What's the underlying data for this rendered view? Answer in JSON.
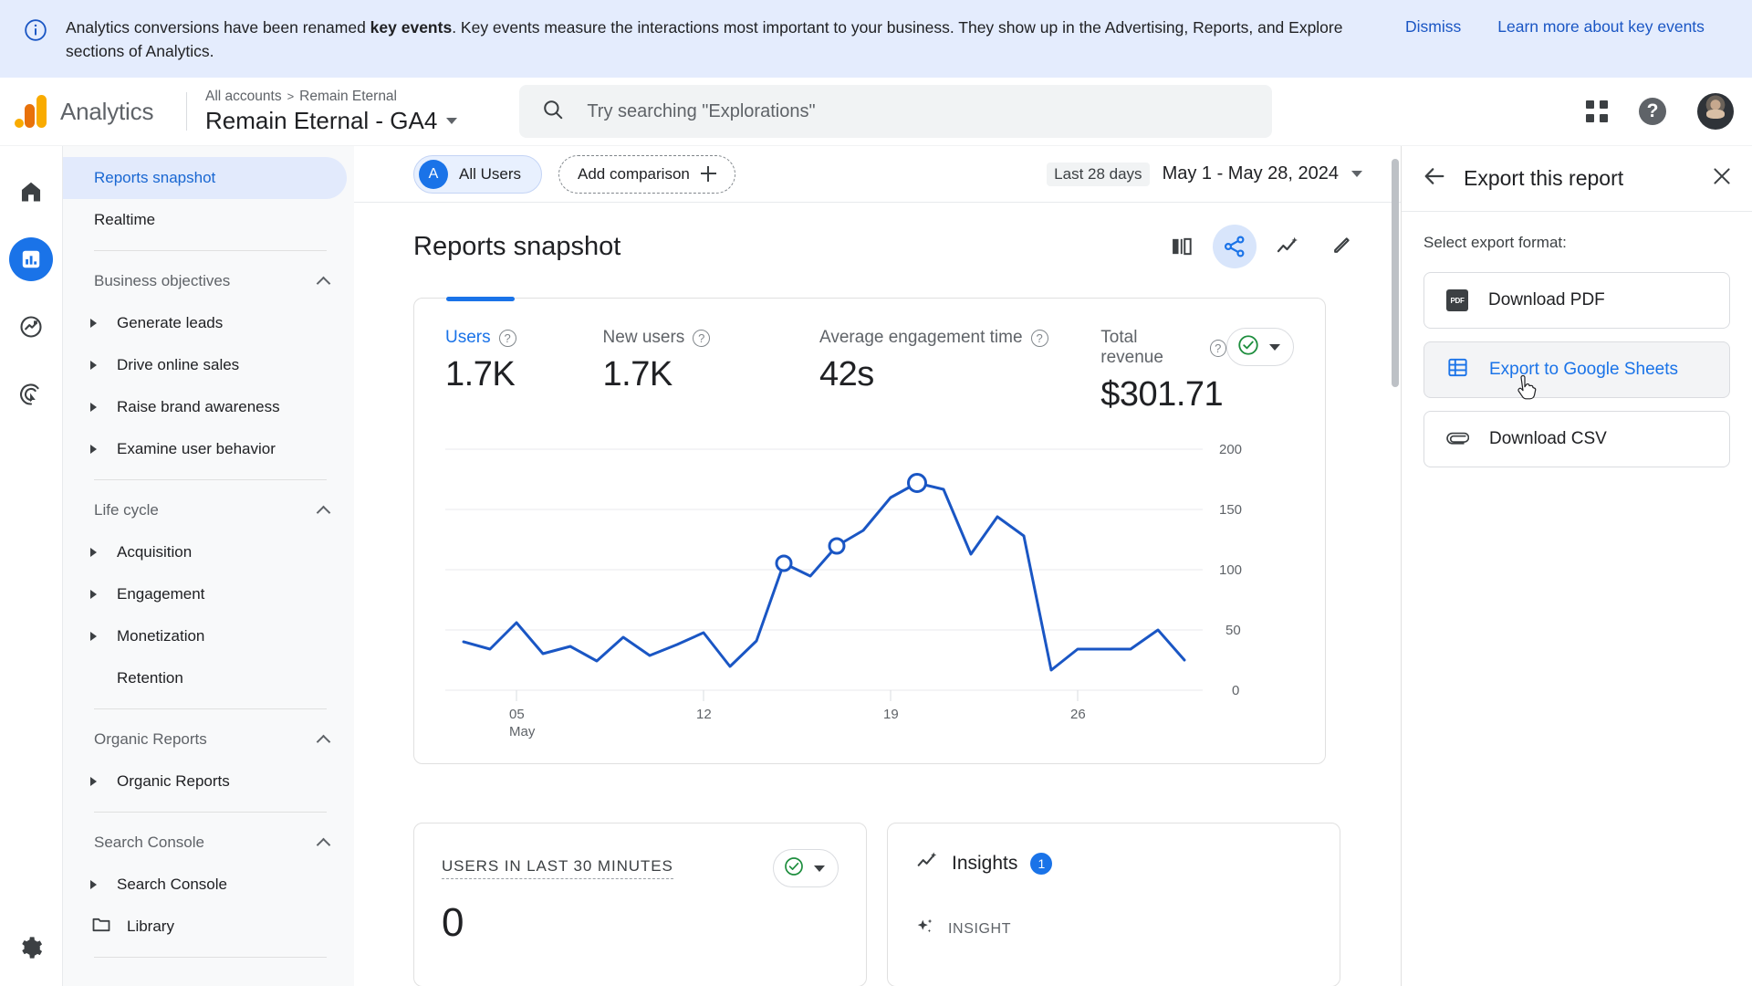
{
  "banner": {
    "icon": "info-icon",
    "text_before": "Analytics conversions have been renamed ",
    "text_bold": "key events",
    "text_after": ". Key events measure the interactions most important to your business. They show up in the Advertising, Reports, and Explore sections of Analytics.",
    "dismiss_label": "Dismiss",
    "learn_more_label": "Learn more about key events"
  },
  "header": {
    "product_name": "Analytics",
    "breadcrumb_root": "All accounts",
    "breadcrumb_separator": ">",
    "breadcrumb_account": "Remain Eternal",
    "property_name": "Remain Eternal - GA4",
    "search_placeholder": "Try searching \"Explorations\"",
    "search_value": "",
    "help_glyph": "?"
  },
  "rail": {
    "items": [
      {
        "name": "home-icon",
        "active": false
      },
      {
        "name": "reports-icon",
        "active": true
      },
      {
        "name": "explore-icon",
        "active": false
      },
      {
        "name": "advertising-icon",
        "active": false
      }
    ],
    "settings_icon": "gear-icon"
  },
  "sidebar": {
    "top_items": [
      {
        "label": "Reports snapshot",
        "selected": true
      },
      {
        "label": "Realtime",
        "selected": false
      }
    ],
    "sections": [
      {
        "title": "Business objectives",
        "collapsed": false,
        "items": [
          {
            "label": "Generate leads",
            "expandable": true
          },
          {
            "label": "Drive online sales",
            "expandable": true
          },
          {
            "label": "Raise brand awareness",
            "expandable": true
          },
          {
            "label": "Examine user behavior",
            "expandable": true
          }
        ]
      },
      {
        "title": "Life cycle",
        "collapsed": false,
        "items": [
          {
            "label": "Acquisition",
            "expandable": true
          },
          {
            "label": "Engagement",
            "expandable": true
          },
          {
            "label": "Monetization",
            "expandable": true
          },
          {
            "label": "Retention",
            "expandable": false
          }
        ]
      },
      {
        "title": "Organic Reports",
        "collapsed": false,
        "items": [
          {
            "label": "Organic Reports",
            "expandable": true
          }
        ]
      },
      {
        "title": "Search Console",
        "collapsed": false,
        "items": [
          {
            "label": "Search Console",
            "expandable": true
          }
        ]
      }
    ],
    "library_label": "Library"
  },
  "controls": {
    "segment_badge": "A",
    "segment_label": "All Users",
    "add_comparison_label": "Add comparison",
    "date_preset": "Last 28 days",
    "date_range": "May 1 - May 28, 2024"
  },
  "main": {
    "page_title": "Reports snapshot",
    "actions": [
      {
        "name": "compare-icon",
        "active": false
      },
      {
        "name": "share-icon",
        "active": true
      },
      {
        "name": "insights-icon",
        "active": false
      },
      {
        "name": "edit-icon",
        "active": false
      }
    ]
  },
  "metric_card": {
    "metrics": [
      {
        "label": "Users",
        "value": "1.7K",
        "active": true
      },
      {
        "label": "New users",
        "value": "1.7K",
        "active": false
      },
      {
        "label": "Average engagement time",
        "value": "42s",
        "active": false
      },
      {
        "label": "Total revenue",
        "value": "$301.71",
        "active": false
      }
    ],
    "status_icon": "check-circle-icon"
  },
  "chart_data": {
    "type": "line",
    "title": "",
    "xlabel": "",
    "ylabel": "",
    "x": [
      "1",
      "2",
      "3",
      "4",
      "5",
      "6",
      "7",
      "8",
      "9",
      "10",
      "11",
      "12",
      "13",
      "14",
      "15",
      "16",
      "17",
      "18",
      "19",
      "20",
      "21",
      "22",
      "23",
      "24",
      "25",
      "26",
      "27",
      "28"
    ],
    "tick_labels": [
      {
        "pos": 5,
        "text": "05",
        "sub": "May"
      },
      {
        "pos": 12,
        "text": "12",
        "sub": ""
      },
      {
        "pos": 19,
        "text": "19",
        "sub": ""
      },
      {
        "pos": 26,
        "text": "26",
        "sub": ""
      }
    ],
    "series": [
      {
        "name": "Users",
        "color": "#1a56c4",
        "values": [
          40,
          34,
          56,
          30,
          36,
          24,
          44,
          29,
          38,
          48,
          20,
          41,
          105,
          95,
          120,
          133,
          160,
          172,
          167,
          113,
          144,
          128,
          17,
          34,
          34,
          34,
          50,
          25
        ]
      }
    ],
    "markers": [
      {
        "x": 13,
        "y": 105
      },
      {
        "x": 15,
        "y": 120
      },
      {
        "x": 18,
        "y": 172
      }
    ],
    "ylim": [
      0,
      200
    ],
    "yticks": [
      0,
      50,
      100,
      150,
      200
    ],
    "grid": true,
    "legend": "none"
  },
  "realtime_card": {
    "label": "USERS IN LAST 30 MINUTES",
    "value": "0",
    "status_icon": "check-circle-icon"
  },
  "insights_card": {
    "title": "Insights",
    "count": "1",
    "section_label": "INSIGHT"
  },
  "export_panel": {
    "back_icon": "arrow-left-icon",
    "title": "Export this report",
    "close_icon": "close-icon",
    "subtitle": "Select export format:",
    "options": [
      {
        "label": "Download PDF",
        "icon": "pdf-icon",
        "hovered": false
      },
      {
        "label": "Export to Google Sheets",
        "icon": "sheets-icon",
        "hovered": true
      },
      {
        "label": "Download CSV",
        "icon": "attachment-icon",
        "hovered": false
      }
    ]
  },
  "colors": {
    "accent_blue": "#1a73e8",
    "line_blue": "#1a56c4",
    "banner_bg": "#e4ecfd",
    "status_green": "#1e8e3e",
    "logo_orange": "#f9ab00"
  }
}
